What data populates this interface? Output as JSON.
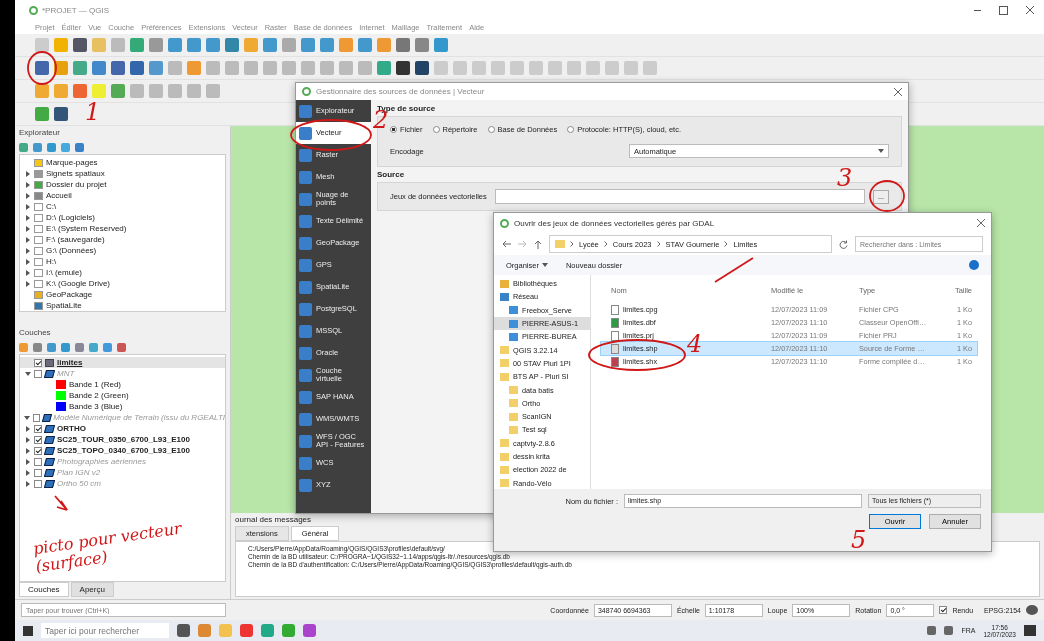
{
  "window": {
    "title": "*PROJET — QGIS"
  },
  "menu": [
    "Projet",
    "Éditer",
    "Vue",
    "Couche",
    "Préférences",
    "Extensions",
    "Vecteur",
    "Raster",
    "Base de données",
    "Internet",
    "Maillage",
    "Traitement",
    "Aide"
  ],
  "explorer": {
    "title": "Explorateur",
    "items": [
      {
        "label": "Marque-pages",
        "kind": "star",
        "arrow": false
      },
      {
        "label": "Signets spatiaux",
        "kind": "bookmark",
        "arrow": true
      },
      {
        "label": "Dossier du projet",
        "kind": "project",
        "arrow": true
      },
      {
        "label": "Accueil",
        "kind": "home",
        "arrow": true
      },
      {
        "label": "C:\\",
        "kind": "drive",
        "arrow": true
      },
      {
        "label": "D:\\ (Logiciels)",
        "kind": "drive",
        "arrow": true
      },
      {
        "label": "E:\\ (System Reserved)",
        "kind": "drive",
        "arrow": true
      },
      {
        "label": "F:\\ (sauvegarde)",
        "kind": "drive",
        "arrow": true
      },
      {
        "label": "G:\\ (Données)",
        "kind": "drive",
        "arrow": true
      },
      {
        "label": "H:\\",
        "kind": "drive",
        "arrow": true
      },
      {
        "label": "I:\\ (emule)",
        "kind": "drive",
        "arrow": true
      },
      {
        "label": "K:\\ (Google Drive)",
        "kind": "drive",
        "arrow": true
      },
      {
        "label": "GeoPackage",
        "kind": "geopackage",
        "arrow": false
      },
      {
        "label": "SpatiaLite",
        "kind": "spatialite",
        "arrow": false
      }
    ]
  },
  "layers": {
    "title": "Couches",
    "items": [
      {
        "label": "limites",
        "kind": "vector",
        "checked": true,
        "selected": true
      },
      {
        "label": "MNT",
        "kind": "raster",
        "checked": false,
        "selected": false,
        "expanded": true,
        "children": [
          {
            "label": "Bande 1 (Red)",
            "color": "#ff0000"
          },
          {
            "label": "Bande 2 (Green)",
            "color": "#00ff00"
          },
          {
            "label": "Bande 3 (Blue)",
            "color": "#0000ff"
          }
        ]
      },
      {
        "label": "Modèle Numérique de Terrain (issu du RGEALTI",
        "kind": "raster",
        "checked": false,
        "selected": false,
        "expanded": true
      },
      {
        "label": "ORTHO",
        "kind": "raster",
        "checked": true,
        "selected": false,
        "expanded": false
      },
      {
        "label": "SC25_TOUR_0350_6700_L93_E100",
        "kind": "raster",
        "checked": true,
        "selected": false,
        "expanded": false
      },
      {
        "label": "SC25_TOPO_0340_6700_L93_E100",
        "kind": "raster",
        "checked": true,
        "selected": false,
        "expanded": false
      },
      {
        "label": "Photographies aériennes",
        "kind": "raster",
        "checked": false,
        "selected": false,
        "expanded": false
      },
      {
        "label": "Plan IGN v2",
        "kind": "raster",
        "checked": false,
        "selected": false,
        "expanded": false
      },
      {
        "label": "Ortho 50 cm",
        "kind": "raster",
        "checked": false,
        "selected": false,
        "expanded": false
      }
    ]
  },
  "left_tabs": [
    {
      "label": "Couches",
      "selected": true
    },
    {
      "label": "Aperçu",
      "selected": false
    }
  ],
  "journal": {
    "title": "ournal des messages",
    "tabs": [
      {
        "label": "xtensions",
        "selected": false
      },
      {
        "label": "Général",
        "selected": true
      }
    ],
    "lines": [
      "C:/Users/Pierre/AppData/Roaming/QGIS/QGIS3\\profiles\\default/svg/",
      "Chemin de la BD utilisateur: C:/PROGRA~1/QGIS32~1.14/apps/qgis-ltr/./resources/qgis.db",
      "Chemin de la BD d'authentification: C:/Users/Pierre/AppData/Roaming/QGIS/QGIS3\\profiles\\default/qgis-auth.db"
    ]
  },
  "status": {
    "locator_placeholder": "Taper pour trouver (Ctrl+K)",
    "coord_label": "Coordonnée",
    "coord": "348740 6694363",
    "scale_label": "Échelle",
    "scale": "1:10178",
    "magnifier_label": "Loupe",
    "magnifier": "100%",
    "rotation_label": "Rotation",
    "rotation": "0,0 °",
    "render_label": "Rendu",
    "render_checked": true,
    "crs": "EPSG:2154"
  },
  "taskbar": {
    "search_placeholder": "Taper ici pour rechercher",
    "lang": "FRA",
    "time": "17:56",
    "date": "12/07/2023"
  },
  "source_manager": {
    "title": "Gestionnaire des sources de données | Vecteur",
    "sidebar": [
      {
        "label": "Explorateur",
        "selected": false
      },
      {
        "label": "Vecteur",
        "selected": true
      },
      {
        "label": "Raster",
        "selected": false
      },
      {
        "label": "Mesh",
        "selected": false
      },
      {
        "label": "Nuage de points",
        "selected": false
      },
      {
        "label": "Texte Délimité",
        "selected": false
      },
      {
        "label": "GeoPackage",
        "selected": false
      },
      {
        "label": "GPS",
        "selected": false
      },
      {
        "label": "SpatiaLite",
        "selected": false
      },
      {
        "label": "PostgreSQL",
        "selected": false
      },
      {
        "label": "MSSQL",
        "selected": false
      },
      {
        "label": "Oracle",
        "selected": false
      },
      {
        "label": "Couche virtuelle",
        "selected": false
      },
      {
        "label": "SAP HANA",
        "selected": false
      },
      {
        "label": "WMS/WMTS",
        "selected": false
      },
      {
        "label": "WFS / OGC API - Features",
        "selected": false
      },
      {
        "label": "WCS",
        "selected": false
      },
      {
        "label": "XYZ",
        "selected": false
      }
    ],
    "source_type_title": "Type de source",
    "source_types": [
      {
        "label": "Fichier",
        "selected": true
      },
      {
        "label": "Répertoire",
        "selected": false
      },
      {
        "label": "Base de Données",
        "selected": false
      },
      {
        "label": "Protocole: HTTP(S), cloud, etc.",
        "selected": false
      }
    ],
    "encoding_label": "Encodage",
    "encoding": "Automatique",
    "source_title": "Source",
    "dataset_label": "Jeux de données vectorielles",
    "browse": "..."
  },
  "file_dialog": {
    "title": "Ouvrir des jeux de données vectorielles gérés par GDAL",
    "breadcrumb": [
      "Lycée",
      "Cours 2023",
      "STAV Gournerie",
      "Limites"
    ],
    "search_placeholder": "Rechercher dans : Limites",
    "organize": "Organiser",
    "new_folder": "Nouveau dossier",
    "nav": [
      {
        "label": "Bibliothèques",
        "kind": "library",
        "selected": false
      },
      {
        "label": "Réseau",
        "kind": "network",
        "selected": false,
        "children": [
          {
            "label": "Freebox_Serve",
            "kind": "computer",
            "selected": false
          },
          {
            "label": "PIERRE-ASUS-1",
            "kind": "computer",
            "selected": true
          },
          {
            "label": "PIERRE-BUREA",
            "kind": "computer",
            "selected": false
          }
        ]
      },
      {
        "label": "QGIS 3.22.14",
        "kind": "folder",
        "selected": false
      },
      {
        "label": "00 STAV Pluri 1PI",
        "kind": "folder",
        "selected": false
      },
      {
        "label": "BTS AP - Pluri SI",
        "kind": "folder",
        "selected": false,
        "children": [
          {
            "label": "data batis",
            "kind": "folder",
            "selected": false
          },
          {
            "label": "Ortho",
            "kind": "folder",
            "selected": false
          },
          {
            "label": "ScanIGN",
            "kind": "folder",
            "selected": false
          },
          {
            "label": "Test sql",
            "kind": "folder",
            "selected": false
          }
        ]
      },
      {
        "label": "captvty-2.8.6",
        "kind": "folder",
        "selected": false
      },
      {
        "label": "dessin krita",
        "kind": "folder",
        "selected": false
      },
      {
        "label": "election 2022 de",
        "kind": "folder",
        "selected": false
      },
      {
        "label": "Rando-Vélo",
        "kind": "folder",
        "selected": false
      }
    ],
    "columns": [
      "Nom",
      "Modifié le",
      "Type",
      "Taille"
    ],
    "files": [
      {
        "name": "limites.cpg",
        "modified": "12/07/2023 11:09",
        "type": "Fichier CPG",
        "size": "1 Ko",
        "kind": "text",
        "selected": false
      },
      {
        "name": "limites.dbf",
        "modified": "12/07/2023 11:10",
        "type": "Classeur OpenOffi…",
        "size": "1 Ko",
        "kind": "sheet",
        "selected": false
      },
      {
        "name": "limites.prj",
        "modified": "12/07/2023 11:09",
        "type": "Fichier PRJ",
        "size": "1 Ko",
        "kind": "text",
        "selected": false
      },
      {
        "name": "limites.shp",
        "modified": "12/07/2023 11:10",
        "type": "Source de Forme …",
        "size": "1 Ko",
        "kind": "shape",
        "selected": true
      },
      {
        "name": "limites.shx",
        "modified": "12/07/2023 11:10",
        "type": "Forme compilée d…",
        "size": "1 Ko",
        "kind": "index",
        "selected": false
      }
    ],
    "filename_label": "Nom du fichier :",
    "filename": "limites.shp",
    "filter": "Tous les fichiers (*)",
    "ok": "Ouvrir",
    "cancel": "Annuler"
  },
  "annotations": [
    {
      "text": "1"
    },
    {
      "text": "2"
    },
    {
      "text": "3"
    },
    {
      "text": "4"
    },
    {
      "text": "5"
    },
    {
      "text": "picto pour vecteur (surface)"
    }
  ]
}
